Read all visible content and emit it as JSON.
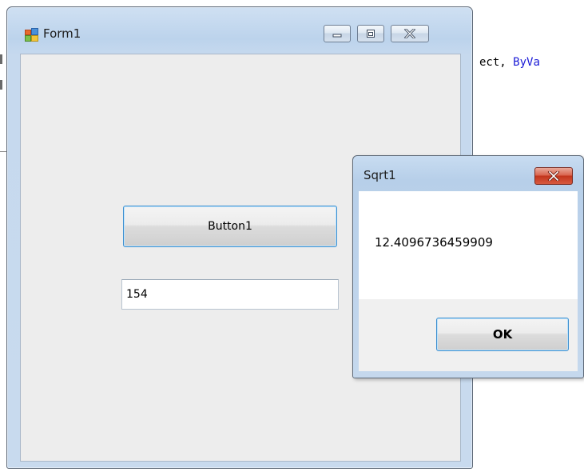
{
  "editor": {
    "code_prefix": "ect, ",
    "code_keyword": "ByVa"
  },
  "form": {
    "title": "Form1",
    "button_label": "Button1",
    "textbox_value": "154",
    "icons": {
      "app": "form-app-icon",
      "minimize": "minimize-icon",
      "maximize": "maximize-icon",
      "close": "close-icon"
    }
  },
  "message_box": {
    "title": "Sqrt1",
    "message": "12.4096736459909",
    "ok_label": "OK",
    "close_icon": "close-icon"
  },
  "colors": {
    "focus_border": "#3c8fd0",
    "close_button": "#c2351c",
    "code_keyword": "#1a1ad6",
    "client_background": "#ededed"
  }
}
